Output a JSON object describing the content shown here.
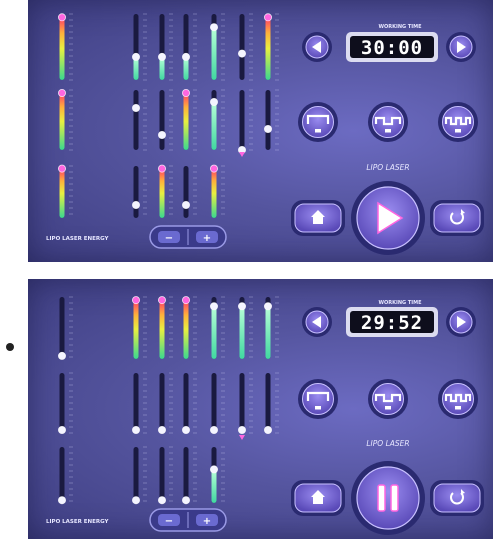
{
  "panels": [
    {
      "timer_title": "WORKING TIME",
      "timer_value": "30:00",
      "mode_label": "LIPO LASER",
      "energy_label": "LIPO LASER ENERGY",
      "minus": "−",
      "plus": "+",
      "action_state": "play",
      "sliders": [
        {
          "level": 0.95,
          "style": "rainbow"
        },
        {
          "level": 0.0,
          "style": "none"
        },
        {
          "level": 0.35,
          "style": "green"
        },
        {
          "level": 0.35,
          "style": "green"
        },
        {
          "level": 0.35,
          "style": "green"
        },
        {
          "level": 0.8,
          "style": "green"
        },
        {
          "level": 0.4,
          "style": "white"
        },
        {
          "level": 0.95,
          "style": "rainbow"
        },
        {
          "level": 0.95,
          "style": "rainbow"
        },
        {
          "level": 0.0,
          "style": "none"
        },
        {
          "level": 0.7,
          "style": "white"
        },
        {
          "level": 0.25,
          "style": "white"
        },
        {
          "level": 0.95,
          "style": "rainbow"
        },
        {
          "level": 0.8,
          "style": "green"
        },
        {
          "level": 0.0,
          "style": "white"
        },
        {
          "level": 0.35,
          "style": "white"
        },
        {
          "level": 0.95,
          "style": "rainbow"
        },
        {
          "level": 0.0,
          "style": "none"
        },
        {
          "level": 0.25,
          "style": "white"
        },
        {
          "level": 0.95,
          "style": "rainbow"
        },
        {
          "level": 0.25,
          "style": "white"
        },
        {
          "level": 0.95,
          "style": "rainbow"
        },
        {
          "level": 0.0,
          "style": "none"
        },
        {
          "level": 0.0,
          "style": "none"
        }
      ]
    },
    {
      "timer_title": "WORKING TIME",
      "timer_value": "29:52",
      "mode_label": "LIPO LASER",
      "energy_label": "LIPO LASER ENERGY",
      "minus": "−",
      "plus": "+",
      "action_state": "pause",
      "sliders": [
        {
          "level": 0.05,
          "style": "white"
        },
        {
          "level": 0.0,
          "style": "none"
        },
        {
          "level": 0.95,
          "style": "rainbow"
        },
        {
          "level": 0.95,
          "style": "rainbow"
        },
        {
          "level": 0.95,
          "style": "rainbow"
        },
        {
          "level": 0.85,
          "style": "green"
        },
        {
          "level": 0.85,
          "style": "green"
        },
        {
          "level": 0.85,
          "style": "green"
        },
        {
          "level": 0.05,
          "style": "white"
        },
        {
          "level": 0.0,
          "style": "none"
        },
        {
          "level": 0.05,
          "style": "white"
        },
        {
          "level": 0.05,
          "style": "white"
        },
        {
          "level": 0.05,
          "style": "white"
        },
        {
          "level": 0.05,
          "style": "white"
        },
        {
          "level": 0.05,
          "style": "white"
        },
        {
          "level": 0.05,
          "style": "white"
        },
        {
          "level": 0.05,
          "style": "white"
        },
        {
          "level": 0.0,
          "style": "none"
        },
        {
          "level": 0.05,
          "style": "white"
        },
        {
          "level": 0.05,
          "style": "white"
        },
        {
          "level": 0.05,
          "style": "white"
        },
        {
          "level": 0.6,
          "style": "green"
        },
        {
          "level": 0.0,
          "style": "none"
        },
        {
          "level": 0.0,
          "style": "none"
        }
      ]
    }
  ],
  "colors": {
    "accent": "#ff66e0",
    "button_ring": "#2a2a70",
    "button_fill": "#7a6ad8",
    "lcd_bg": "#0e0e1c",
    "lcd_text": "#ffffff"
  },
  "icons": [
    "left-arrow-icon",
    "right-arrow-icon",
    "mode-pulse-icon",
    "home-icon",
    "play-icon",
    "pause-icon",
    "reset-icon"
  ]
}
